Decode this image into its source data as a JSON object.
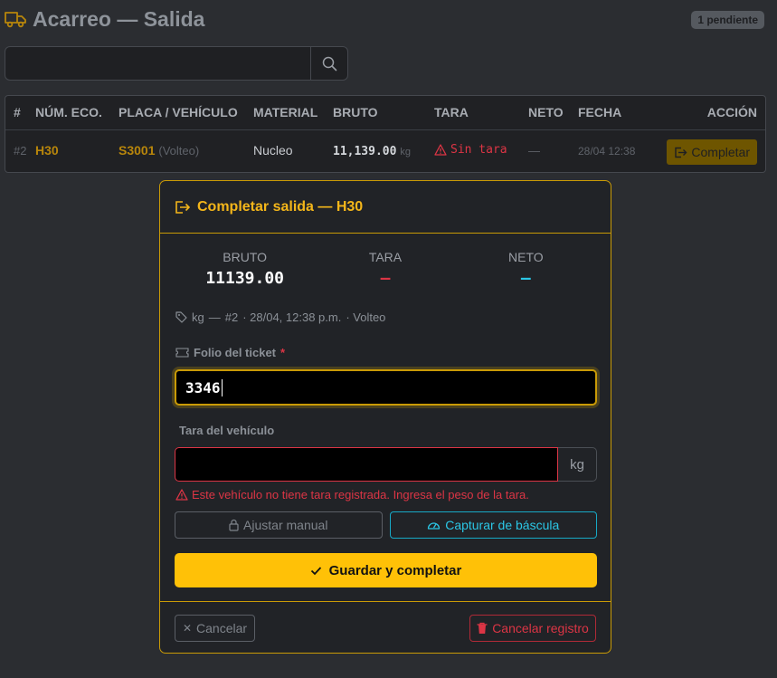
{
  "header": {
    "title": "Acarreo — Salida",
    "badge": "1 pendiente",
    "icon": "truck-icon"
  },
  "search": {
    "placeholder": "",
    "icon": "search-icon"
  },
  "table": {
    "headers": [
      "#",
      "NÚM. ECO.",
      "PLACA / VEHÍCULO",
      "MATERIAL",
      "BRUTO",
      "TARA",
      "NETO",
      "FECHA",
      "ACCIÓN"
    ],
    "rows": [
      {
        "num": "#2",
        "eco": "H30",
        "placa": "S3001",
        "vehiculo": "(Volteo)",
        "material": "Nucleo",
        "bruto": "11,139.00",
        "bruto_unit": "kg",
        "tara": "Sin tara",
        "neto": "—",
        "fecha": "28/04 12:38",
        "accion": "Completar"
      }
    ]
  },
  "modal": {
    "title": "Completar salida — H30",
    "stats": {
      "bruto_label": "BRUTO",
      "bruto_value": "11139.00",
      "tara_label": "TARA",
      "tara_value": "—",
      "neto_label": "NETO",
      "neto_value": "—"
    },
    "meta": {
      "unit": "kg",
      "sep": "—",
      "num": "#2",
      "date": "· 28/04, 12:38 p.m.",
      "type": "· Volteo"
    },
    "ticket": {
      "label": "Folio del ticket",
      "required": "*",
      "value": "3346"
    },
    "tara": {
      "label": "Tara del vehículo",
      "value": "",
      "unit": "kg"
    },
    "error": "Este vehículo no tiene tara registrada. Ingresa el peso de la tara.",
    "buttons": {
      "manual": "Ajustar manual",
      "bascula": "Capturar de báscula",
      "save": "Guardar y completar",
      "cancel": "Cancelar",
      "delete": "Cancelar registro"
    }
  },
  "colors": {
    "accent": "#ffc107",
    "modal_border": "#c99a06",
    "danger": "#dc3545",
    "info": "#17a9c6"
  }
}
